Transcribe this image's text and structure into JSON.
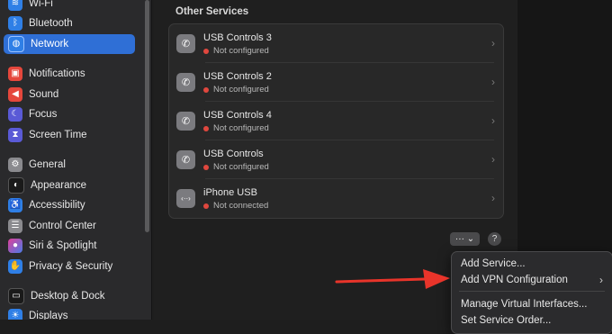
{
  "sidebar": {
    "items": [
      {
        "label": "Wi-Fi",
        "icon": "wifi-icon",
        "color": "#2f7fe6",
        "glyph": "≋"
      },
      {
        "label": "Bluetooth",
        "icon": "bluetooth-icon",
        "color": "#2f7fe6",
        "glyph": "ᛒ"
      },
      {
        "label": "Network",
        "icon": "globe-icon",
        "color": "#2f7fe6",
        "glyph": "◍",
        "selected": true
      },
      {
        "label": "Notifications",
        "icon": "bell-icon",
        "color": "#e5473c",
        "glyph": "▣"
      },
      {
        "label": "Sound",
        "icon": "speaker-icon",
        "color": "#e5473c",
        "glyph": "◀"
      },
      {
        "label": "Focus",
        "icon": "moon-icon",
        "color": "#5a5ad6",
        "glyph": "☾"
      },
      {
        "label": "Screen Time",
        "icon": "hourglass-icon",
        "color": "#5a5ad6",
        "glyph": "⧗"
      },
      {
        "label": "General",
        "icon": "gear-icon",
        "color": "#8a8a8e",
        "glyph": "⚙"
      },
      {
        "label": "Appearance",
        "icon": "appearance-icon",
        "color": "#1a1a1a",
        "glyph": "◐"
      },
      {
        "label": "Accessibility",
        "icon": "accessibility-icon",
        "color": "#2f7fe6",
        "glyph": "♿"
      },
      {
        "label": "Control Center",
        "icon": "control-center-icon",
        "color": "#8a8a8e",
        "glyph": "☰"
      },
      {
        "label": "Siri & Spotlight",
        "icon": "siri-icon",
        "color": "#b04ad6",
        "glyph": "●"
      },
      {
        "label": "Privacy & Security",
        "icon": "hand-icon",
        "color": "#2f7fe6",
        "glyph": "✋"
      },
      {
        "label": "Desktop & Dock",
        "icon": "dock-icon",
        "color": "#1a1a1a",
        "glyph": "▭"
      },
      {
        "label": "Displays",
        "icon": "display-icon",
        "color": "#2f7fe6",
        "glyph": "☀"
      }
    ]
  },
  "main": {
    "section_title": "Other Services",
    "services": [
      {
        "name": "USB Controls 3",
        "status": "Not configured",
        "icon": "phone-icon"
      },
      {
        "name": "USB Controls 2",
        "status": "Not configured",
        "icon": "phone-icon"
      },
      {
        "name": "USB Controls 4",
        "status": "Not configured",
        "icon": "phone-icon"
      },
      {
        "name": "USB Controls",
        "status": "Not configured",
        "icon": "phone-icon"
      },
      {
        "name": "iPhone USB",
        "status": "Not connected",
        "icon": "usb-connection-icon"
      }
    ],
    "action_button": "··· ⌄",
    "help_button": "?"
  },
  "menu": {
    "items": [
      "Add Service...",
      "Add VPN Configuration",
      "Manage Virtual Interfaces...",
      "Set Service Order..."
    ]
  },
  "colors": {
    "accent": "#2f6fd6",
    "status_red": "#e0473e",
    "annotation_arrow": "#e8342a"
  }
}
